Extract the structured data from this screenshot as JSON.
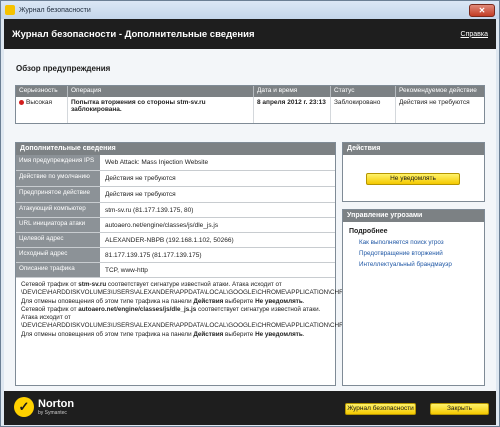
{
  "window": {
    "title": "Журнал безопасности",
    "close_glyph": "✕"
  },
  "header": {
    "title": "Журнал безопасности - Дополнительные сведения",
    "help": "Справка"
  },
  "overview": {
    "title": "Обзор предупреждения",
    "columns": [
      "Серьезность",
      "Операция",
      "Дата и время",
      "Статус",
      "Рекомендуемое действие"
    ],
    "row": {
      "severity": "Высокая",
      "operation": "Попытка вторжения со стороны stm-sv.ru заблокирована.",
      "datetime": "8 апреля 2012 г. 23:13",
      "status": "Заблокировано",
      "action": "Действия не требуются"
    }
  },
  "details": {
    "title": "Дополнительные сведения",
    "rows": [
      {
        "label": "Имя предупреждения IPS",
        "value": "Web Attack: Mass Injection Website"
      },
      {
        "label": "Действие по умолчанию",
        "value": "Действия не требуются"
      },
      {
        "label": "Предпринятое действие",
        "value": "Действия не требуются"
      },
      {
        "label": "Атакующий компьютер",
        "value": "stm-sv.ru (81.177.139.175, 80)"
      },
      {
        "label": "URL инициатора атаки",
        "value": "autoaero.net/engine/classes/js/dle_js.js"
      },
      {
        "label": "Целевой адрес",
        "value": "ALEXANDER-NBPB (192.168.1.102, 50266)"
      },
      {
        "label": "Исходный адрес",
        "value": "81.177.139.175 (81.177.139.175)"
      },
      {
        "label": "Описание трафика",
        "value": "TCP, www-http"
      }
    ],
    "description": {
      "p1": "Сетевой трафик от ",
      "p1_bold": "stm-sv.ru",
      "p2": " соответствует сигнатуре известной атаки. Атака исходит от \\DEVICE\\HARDDISKVOLUME3\\USERS\\ALEXANDER\\APPDATA\\LOCAL\\GOOGLE\\CHROME\\APPLICATION\\CHROME.EXE. Для отмены оповещения об этом типе трафика на панели ",
      "p2_bold": "Действия",
      "p3": " выберите ",
      "p3_bold": "Не уведомлять",
      "p4": ". Сетевой трафик от ",
      "p4_bold": "autoaero.net/engine/classes/js/dle_js.js",
      "p5": " соответствует сигнатуре известной атаки. Атака исходит от \\DEVICE\\HARDDISKVOLUME3\\USERS\\ALEXANDER\\APPDATA\\LOCAL\\GOOGLE\\CHROME\\APPLICATION\\CHROME.EXE. Для отмены оповещения об этом типе трафика на панели ",
      "p5_bold": "Действия",
      "p6": " выберите ",
      "p6_bold": "Не уведомлять",
      "p7": "."
    }
  },
  "actions": {
    "title": "Действия",
    "button": "Не уведомлять"
  },
  "threats": {
    "title": "Управление угрозами",
    "subtitle": "Подробнее",
    "links": [
      "Как выполняется поиск угроз",
      "Предотвращение вторжений",
      "Интеллектуальный брандмауэр"
    ]
  },
  "footer": {
    "brand": "Norton",
    "by": "by Symantec",
    "journal_button": "Журнал безопасности",
    "close_button": "Закрыть"
  },
  "colors": {
    "accent_yellow": "#f4c900",
    "header_dark": "#1e1e1e",
    "severity_high": "#d21d1d",
    "link": "#1f57a5"
  }
}
